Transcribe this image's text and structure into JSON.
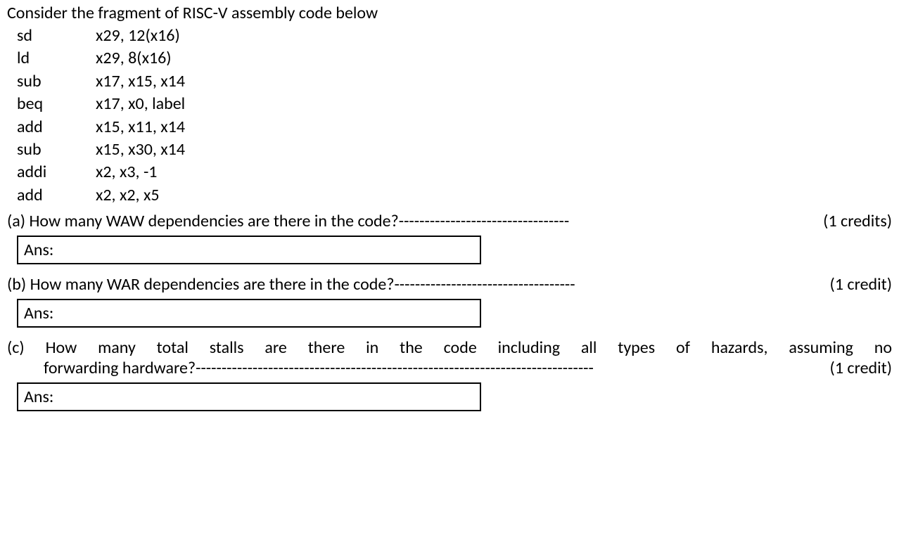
{
  "intro": "Consider the fragment of RISC-V assembly code below",
  "asm": [
    {
      "mn": "sd",
      "ops": "x29, 12(x16)"
    },
    {
      "mn": "ld",
      "ops": "x29, 8(x16)"
    },
    {
      "mn": "sub",
      "ops": "x17, x15, x14"
    },
    {
      "mn": "beq",
      "ops": "x17, x0, label"
    },
    {
      "mn": "add",
      "ops": "x15, x11, x14"
    },
    {
      "mn": "sub",
      "ops": "x15, x30, x14"
    },
    {
      "mn": "addi",
      "ops": "x2, x3, -1"
    },
    {
      "mn": "add",
      "ops": "x2, x2, x5"
    }
  ],
  "qa": {
    "label": "(a)  How many WAW dependencies are there in the code?",
    "dashes": "---------------------------------",
    "credits": "(1 credits)",
    "ans_prefix": "Ans:"
  },
  "qb": {
    "label": "(b)  How many WAR dependencies are there in the code?",
    "dashes": "-----------------------------------",
    "credits": "(1 credit)",
    "ans_prefix": "Ans:"
  },
  "qc": {
    "line1": "(c)  How many total stalls are there in the code including all types of hazards, assuming no",
    "line2": "forwarding hardware?",
    "dashes": "-----------------------------------------------------------------------------",
    "credits": "(1 credit)",
    "ans_prefix": "Ans:"
  }
}
